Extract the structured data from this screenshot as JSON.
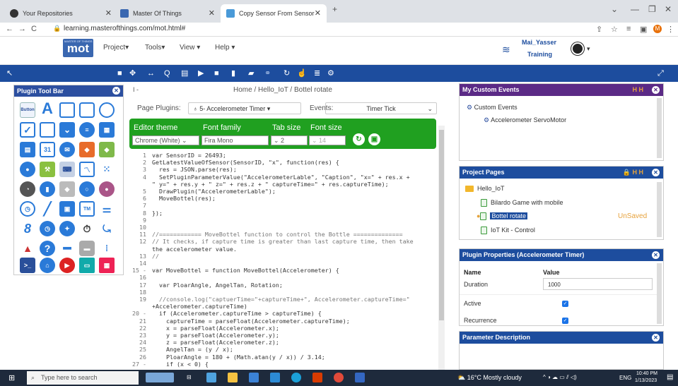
{
  "browser": {
    "tabs": [
      {
        "label": "Your Repositories"
      },
      {
        "label": "Master Of Things"
      },
      {
        "label": "Copy Sensor From Sensor"
      }
    ],
    "url": "learning.masterofthings.com/mot.html#"
  },
  "app": {
    "logo_text": "mot",
    "logo_small": "MASTER OF THINGS",
    "menu": [
      "Project",
      "Tools",
      "View",
      "Help"
    ],
    "user_name": "Mai_Yasser",
    "user_role": "Training"
  },
  "plugin_toolbar": {
    "title": "Plugin Tool Bar",
    "first_icon_label": "Button"
  },
  "center": {
    "breadcrumb": "Home  /  Hello_IoT  /  Bottel rotate",
    "collapse_label": "I -",
    "plugins_label": "Page Plugins:",
    "plugins_value": "5- Accelerometer Timer",
    "events_label": "Events:",
    "events_value": "Timer Tick",
    "editor_theme_label": "Editor theme",
    "font_family_label": "Font family",
    "tab_size_label": "Tab size",
    "font_size_label": "Font size",
    "editor_theme_value": "Chrome (White)",
    "font_family_value": "Fira Mono",
    "tab_size_value": "2",
    "font_size_value": "14"
  },
  "code_lines": [
    {
      "n": "1",
      "t": "var SensorID = 26493;"
    },
    {
      "n": "2",
      "t": "GetLatestValueOfSensor(SensorID, \"x\", function(res) {"
    },
    {
      "n": "3",
      "t": "  res = JSON.parse(res);"
    },
    {
      "n": "4",
      "t": "  SetPluginParameterValue(\"AccelerometerLable\", \"Caption\", \"x=\" + res.x +"
    },
    {
      "n": "",
      "t": "\" y=\" + res.y + \" z=\" + res.z + \" captureTime=\" + res.captureTime);"
    },
    {
      "n": "5",
      "t": "  DrawPlugin(\"AccelerometerLable\");"
    },
    {
      "n": "6",
      "t": "  MoveBottel(res);"
    },
    {
      "n": "7",
      "t": ""
    },
    {
      "n": "8",
      "t": "});"
    },
    {
      "n": "9",
      "t": ""
    },
    {
      "n": "10",
      "t": ""
    },
    {
      "n": "11",
      "t": "//============ MoveBottel function to control the Bottle =============="
    },
    {
      "n": "12",
      "t": "// It checks, if capture time is greater than last capture time, then take"
    },
    {
      "n": "",
      "t": "the accelerometer value."
    },
    {
      "n": "13",
      "t": "//"
    },
    {
      "n": "14",
      "t": ""
    },
    {
      "n": "15 -",
      "t": "var MoveBottel = function MoveBottel(Accelerometer) {"
    },
    {
      "n": "16",
      "t": ""
    },
    {
      "n": "17",
      "t": "  var PloarAngle, AngelTan, Rotation;"
    },
    {
      "n": "18",
      "t": ""
    },
    {
      "n": "19",
      "t": "  //console.log(\"captuerTime=\"+captureTime+\", Accelerometer.captureTime=\""
    },
    {
      "n": "",
      "t": "+Accelerometer.captureTime)"
    },
    {
      "n": "20 -",
      "t": "  if (Accelerometer.captureTime > captureTime) {"
    },
    {
      "n": "21",
      "t": "    captureTime = parseFloat(Accelerometer.captureTime);"
    },
    {
      "n": "22",
      "t": "    x = parseFloat(Accelerometer.x);"
    },
    {
      "n": "23",
      "t": "    y = parseFloat(Accelerometer.y);"
    },
    {
      "n": "24",
      "t": "    z = parseFloat(Accelerometer.z);"
    },
    {
      "n": "25",
      "t": "    AngelTan = (y / x);"
    },
    {
      "n": "26",
      "t": "    PloarAngle = 180 + (Math.atan(y / x)) / 3.14;"
    },
    {
      "n": "27 -",
      "t": "    if (x < 0) {"
    }
  ],
  "custom_events": {
    "title": "My Custom Events",
    "root": "Custom Events",
    "child": "Accelerometer ServoMotor"
  },
  "project_pages": {
    "title": "Project Pages",
    "folder": "Hello_IoT",
    "pages": [
      "Bilardo Game with mobile",
      "Bottel rotate",
      "IoT Kit - Control"
    ],
    "unsaved": "UnSaved"
  },
  "plugin_properties": {
    "title": "Plugin Properties (Accelerometer Timer)",
    "col_name": "Name",
    "col_value": "Value",
    "rows": [
      {
        "name": "Duration",
        "value": "1000"
      },
      {
        "name": "Active",
        "value": ""
      },
      {
        "name": "Recurrence",
        "value": ""
      }
    ]
  },
  "parameter_description": {
    "title": "Parameter Description"
  },
  "taskbar": {
    "search_placeholder": "Type here to search",
    "weather": "16°C  Mostly cloudy",
    "lang": "ENG",
    "time": "10:40 PM",
    "date": "1/13/2023"
  },
  "colors": {
    "brand_blue": "#1d4d9e",
    "editor_green": "#20a020",
    "custom_events_purple": "#5b2a86",
    "unsaved_orange": "#e6a23c"
  }
}
